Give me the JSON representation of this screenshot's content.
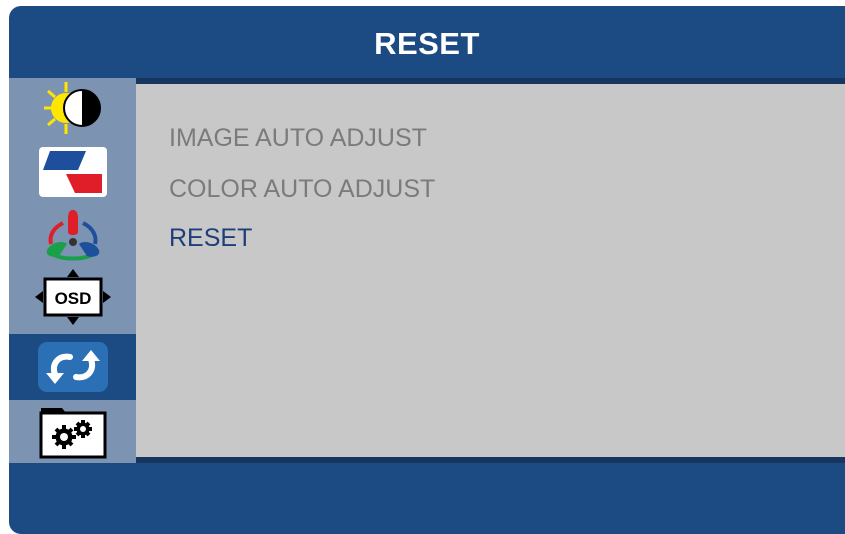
{
  "header": {
    "title": "RESET"
  },
  "sidebar": {
    "items": [
      {
        "icon": "brightness-contrast-icon",
        "active": false
      },
      {
        "icon": "image-settings-icon",
        "active": false
      },
      {
        "icon": "color-settings-icon",
        "active": false
      },
      {
        "icon": "osd-position-icon",
        "label": "OSD",
        "active": false
      },
      {
        "icon": "reset-icon",
        "active": true
      },
      {
        "icon": "system-settings-icon",
        "active": false
      }
    ]
  },
  "menu": {
    "items": [
      {
        "label": "IMAGE AUTO ADJUST",
        "selected": false
      },
      {
        "label": "COLOR AUTO ADJUST",
        "selected": false
      },
      {
        "label": "RESET",
        "selected": true
      }
    ]
  },
  "colors": {
    "frame": "#1c4a82",
    "sidebar": "#7d93b2",
    "content": "#c8c8c8",
    "menu_text": "#7b7b7b",
    "menu_selected": "#1c3f7a"
  }
}
